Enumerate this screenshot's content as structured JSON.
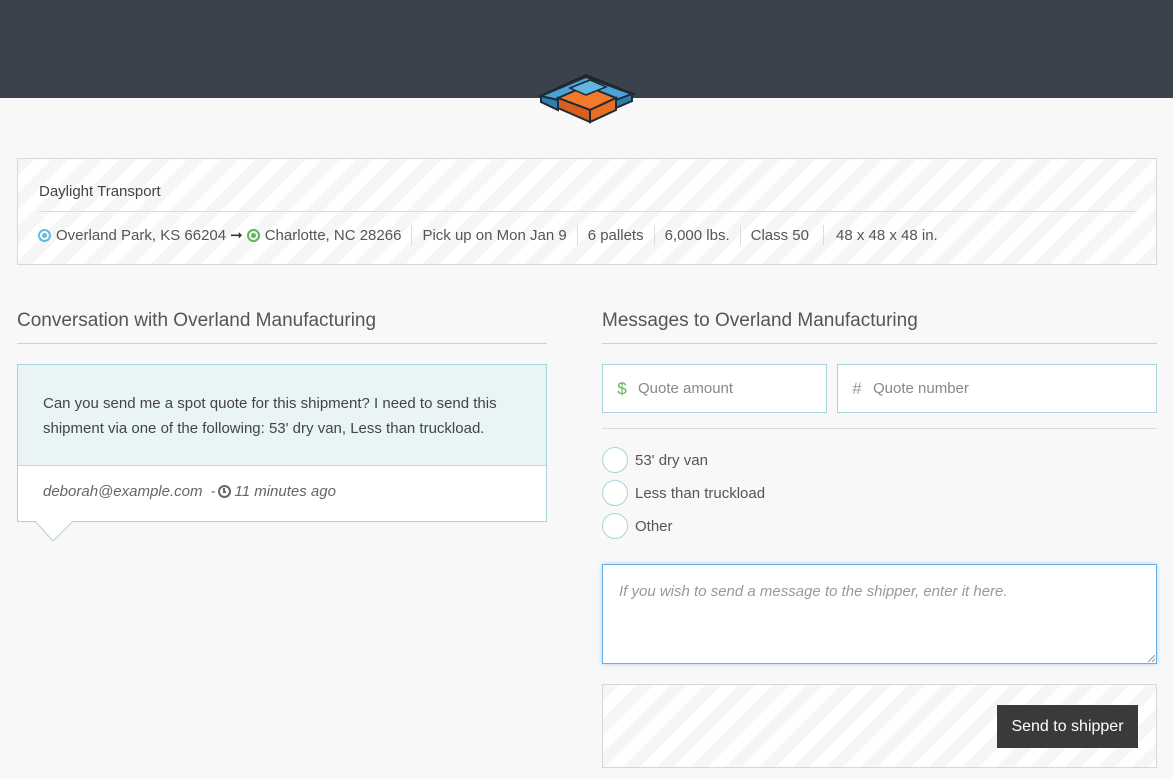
{
  "header": {
    "logo_icon": "box-logo-icon"
  },
  "shipment": {
    "carrier": "Daylight Transport",
    "origin": "Overland Park, KS 66204",
    "arrow": "➞",
    "destination": "Charlotte, NC 28266",
    "pickup": "Pick up on Mon Jan 9",
    "pallets": "6 pallets",
    "weight": "6,000 lbs.",
    "freight_class": "Class 50",
    "dimensions": "48 x 48 x 48 in."
  },
  "conversation": {
    "title": "Conversation with Overland Manufacturing",
    "message": {
      "body": "Can you send me a spot quote for this shipment? I need to send this shipment via one of the following: 53' dry van, Less than truckload.",
      "sender": "deborah@example.com",
      "separator": "-",
      "time": "11 minutes ago"
    }
  },
  "messages": {
    "title": "Messages to Overland Manufacturing",
    "quote_amount_placeholder": "Quote amount",
    "quote_number_placeholder": "Quote number",
    "options": [
      "53' dry van",
      "Less than truckload",
      "Other"
    ],
    "message_placeholder": "If you wish to send a message to the shipper, enter it here.",
    "send_label": "Send to shipper"
  },
  "colors": {
    "topbar": "#3b414d",
    "accent_border": "#a9d4dc",
    "origin": "#5bc0de",
    "destination": "#5cb85c",
    "button": "#3a3a3a"
  }
}
